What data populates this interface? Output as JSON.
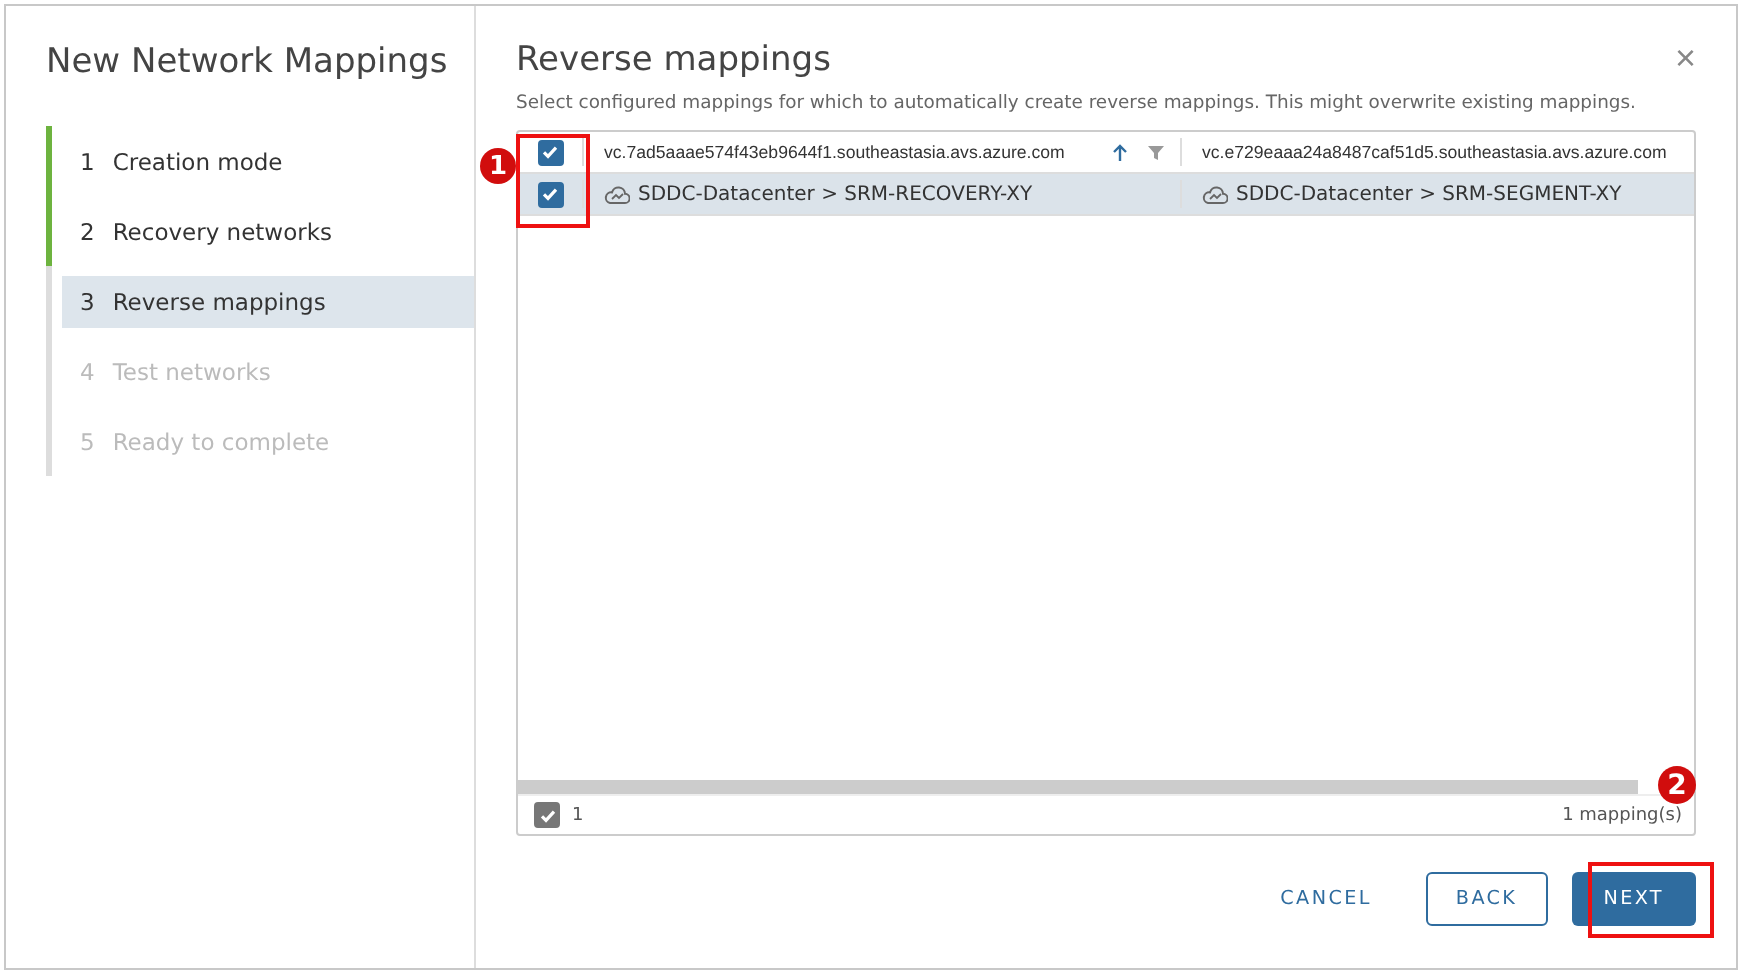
{
  "wizard": {
    "title": "New Network Mappings",
    "steps": [
      {
        "number": "1",
        "label": "Creation mode",
        "done": true,
        "selected": false,
        "disabled": false
      },
      {
        "number": "2",
        "label": "Recovery networks",
        "done": true,
        "selected": false,
        "disabled": false
      },
      {
        "number": "3",
        "label": "Reverse mappings",
        "done": false,
        "selected": true,
        "disabled": false
      },
      {
        "number": "4",
        "label": "Test networks",
        "done": false,
        "selected": false,
        "disabled": true
      },
      {
        "number": "5",
        "label": "Ready to complete",
        "done": false,
        "selected": false,
        "disabled": true
      }
    ]
  },
  "page": {
    "title": "Reverse mappings",
    "close": "×",
    "description": "Select configured mappings for which to automatically create reverse mappings. This might overwrite existing mappings."
  },
  "table": {
    "select_all": {
      "checked": true
    },
    "columns": [
      {
        "label": "vc.7ad5aaae574f43eb9644f1.southeastasia.avs.azure.com",
        "sorted": true,
        "filter": true
      },
      {
        "label": "vc.e729eaaa24a8487caf51d5.southeastasia.avs.azure.com"
      }
    ],
    "rows": [
      {
        "checked": true,
        "selected": true,
        "cells": [
          "SDDC-Datacenter > SRM-RECOVERY-XY",
          "SDDC-Datacenter > SRM-SEGMENT-XY"
        ]
      }
    ],
    "footer": {
      "checked": true,
      "selected_count": "1",
      "total": "1 mapping(s)"
    }
  },
  "buttons": [
    {
      "label": "CANCEL",
      "kind": "flat"
    },
    {
      "label": "BACK",
      "kind": "outline"
    },
    {
      "label": "NEXT",
      "kind": "primary"
    }
  ],
  "annotations": [
    {
      "label": "1"
    },
    {
      "label": "2"
    }
  ]
}
